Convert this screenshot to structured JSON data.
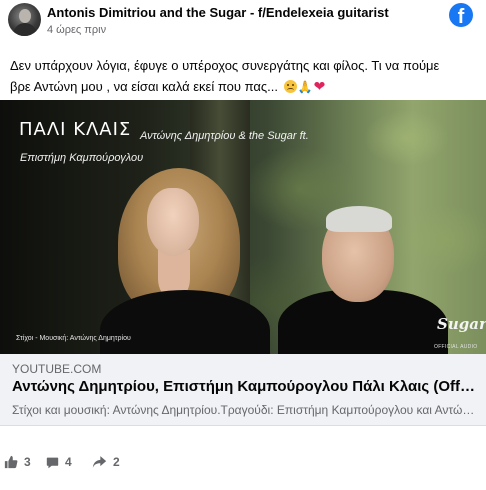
{
  "header": {
    "author": "Antonis Dimitriou and the Sugar - f/Endelexeia guitarist",
    "timestamp": "4 ώρες πριν",
    "facebook_logo_icon": "facebook-logo-icon",
    "brand_color": "#1877f2"
  },
  "message": {
    "text_line1": "Δεν υπάρχουν λόγια, έφυγε ο υπέροχος συνεργάτης και φίλος. Τι να πούμε",
    "text_line2": "βρε Αντώνη μου , να είσαι καλά εκεί που πας...",
    "emojis": [
      "sad-face-emoji",
      "praying-hands-emoji",
      "red-heart-emoji"
    ]
  },
  "thumbnail": {
    "title": "ΠΑΛΙ ΚΛΑΙΣ",
    "artist": "Αντώνης Δημητρίου & the Sugar ft.",
    "featuring": "Επιστήμη Καμπούρογλου",
    "credit": "Στίχοι - Μουσική: Αντώνης Δημητρίου",
    "logo_text": "Sugar",
    "audio_label": "OFFICIAL AUDIO"
  },
  "link_preview": {
    "domain": "YOUTUBE.COM",
    "title": "Αντώνης Δημητρίου, Επιστήμη Καμπούρογλου Πάλι Κλαις (Official Audio)",
    "description": "Στίχοι και μουσική: Αντώνης Δημητρίου.Τραγούδι: Επιστήμη Καμπούρογλου και Αντώνης Δημητρίου"
  },
  "stats": {
    "likes": "3",
    "comments": "4",
    "shares": "2",
    "icon_color": "#65676b"
  }
}
